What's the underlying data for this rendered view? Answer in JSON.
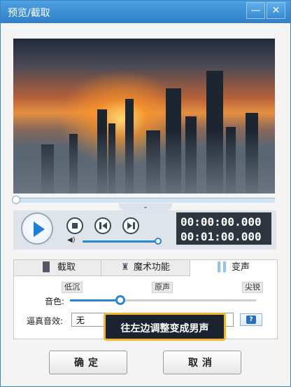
{
  "window": {
    "title": "预览/截取",
    "min_glyph": "—",
    "close_glyph": "✕"
  },
  "player": {
    "current_time": "00:00:00.000",
    "total_time": "00:01:00.000",
    "progress": 0.0,
    "volume": 1.0,
    "dropdown_glyph": "⌄"
  },
  "tabs": [
    {
      "label": "截取",
      "icon": "film-icon",
      "glyph": "▐▌"
    },
    {
      "label": "魔术功能",
      "icon": "magic-hat-icon",
      "glyph": "♜"
    },
    {
      "label": "变声",
      "icon": "sound-wave-icon",
      "glyph": "║║"
    }
  ],
  "voice": {
    "scale_low": "低沉",
    "scale_mid": "原声",
    "scale_high": "尖锐",
    "tone_label": "音色:",
    "tone_value": 0.27,
    "effect_label": "逼真音效:",
    "effect_value": "无",
    "help_glyph": "?"
  },
  "tooltip": "往左边调整变成男声",
  "buttons": {
    "ok": "确定",
    "cancel": "取消"
  },
  "colors": {
    "accent": "#2a86d6",
    "titlebar": "#3a8ad2",
    "tooltip_border": "#f1b52e"
  }
}
